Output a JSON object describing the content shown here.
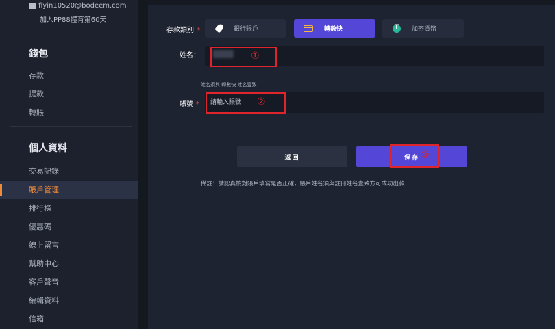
{
  "sidebar": {
    "email": "fiyin10520@bodeem.com",
    "days": "加入PP88體育第60天",
    "wallet": {
      "title": "錢包",
      "items": [
        "存款",
        "提款",
        "轉賬"
      ]
    },
    "profile": {
      "title": "個人資料",
      "items": [
        "交易記錄",
        "賬戶管理",
        "排行榜",
        "優惠碼",
        "線上留言",
        "幫助中心",
        "客戶聲音",
        "編輯資料",
        "信箱"
      ],
      "active_index": 1
    }
  },
  "form": {
    "deposit_type_label": "存款類別",
    "required_mark": "*",
    "types": [
      {
        "label": "銀行賬戶",
        "icon": "rocket-icon"
      },
      {
        "label": "轉數快",
        "icon": "card-icon",
        "selected": true
      },
      {
        "label": "加密貨幣",
        "icon": "tether-icon"
      }
    ],
    "name_label": "姓名：",
    "name_hint": "姓名須與 轉數快 姓名壹致",
    "account_label": "賬號",
    "account_placeholder": "請輸入賬號",
    "back_button": "返回",
    "save_button": "保存",
    "note": "備註：請認真核對賬戶填寫是否正確，賬戶姓名須與註冊姓名壹致方可成功出款"
  },
  "annotations": [
    "①",
    "②",
    "③"
  ],
  "colors": {
    "accent": "#5446d6",
    "active_menu": "#ee8a3b",
    "annotation_red": "#e0242c"
  }
}
